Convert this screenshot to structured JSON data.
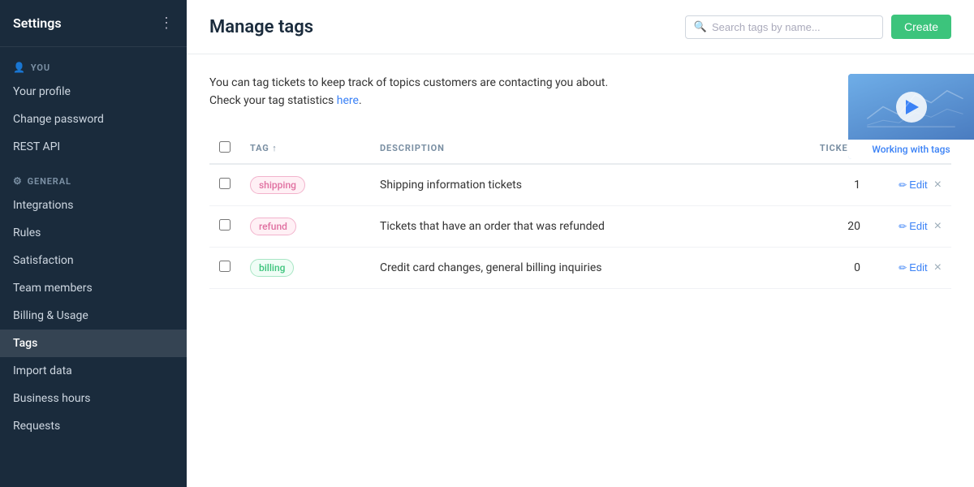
{
  "sidebar": {
    "title": "Settings",
    "dots_icon": "⋮",
    "sections": [
      {
        "label": "YOU",
        "icon": "👤",
        "items": [
          {
            "id": "your-profile",
            "label": "Your profile",
            "active": false
          },
          {
            "id": "change-password",
            "label": "Change password",
            "active": false
          },
          {
            "id": "rest-api",
            "label": "REST API",
            "active": false
          }
        ]
      },
      {
        "label": "GENERAL",
        "icon": "⚙",
        "items": [
          {
            "id": "integrations",
            "label": "Integrations",
            "active": false
          },
          {
            "id": "rules",
            "label": "Rules",
            "active": false
          },
          {
            "id": "satisfaction",
            "label": "Satisfaction",
            "active": false
          },
          {
            "id": "team-members",
            "label": "Team members",
            "active": false
          },
          {
            "id": "billing-usage",
            "label": "Billing & Usage",
            "active": false
          },
          {
            "id": "tags",
            "label": "Tags",
            "active": true
          },
          {
            "id": "import-data",
            "label": "Import data",
            "active": false
          },
          {
            "id": "business-hours",
            "label": "Business hours",
            "active": false
          },
          {
            "id": "requests",
            "label": "Requests",
            "active": false
          }
        ]
      }
    ]
  },
  "header": {
    "title": "Manage tags",
    "search_placeholder": "Search tags by name...",
    "create_button_label": "Create"
  },
  "intro": {
    "line1": "You can tag tickets to keep track of topics customers are contacting you about.",
    "line2": "Check your tag statistics ",
    "link_text": "here",
    "line2_end": "."
  },
  "video": {
    "label": "Working with tags"
  },
  "table": {
    "columns": [
      {
        "id": "checkbox",
        "label": ""
      },
      {
        "id": "tag",
        "label": "TAG ↑"
      },
      {
        "id": "description",
        "label": "DESCRIPTION"
      },
      {
        "id": "tickets",
        "label": "TICKETS"
      },
      {
        "id": "actions",
        "label": ""
      }
    ],
    "rows": [
      {
        "id": "shipping",
        "tag_label": "shipping",
        "tag_style": "shipping",
        "description": "Shipping information tickets",
        "tickets": 1,
        "edit_label": "Edit",
        "delete_label": "×"
      },
      {
        "id": "refund",
        "tag_label": "refund",
        "tag_style": "refund",
        "description": "Tickets that have an order that was refunded",
        "tickets": 20,
        "edit_label": "Edit",
        "delete_label": "×"
      },
      {
        "id": "billing",
        "tag_label": "billing",
        "tag_style": "billing",
        "description": "Credit card changes, general billing inquiries",
        "tickets": 0,
        "edit_label": "Edit",
        "delete_label": "×"
      }
    ]
  }
}
